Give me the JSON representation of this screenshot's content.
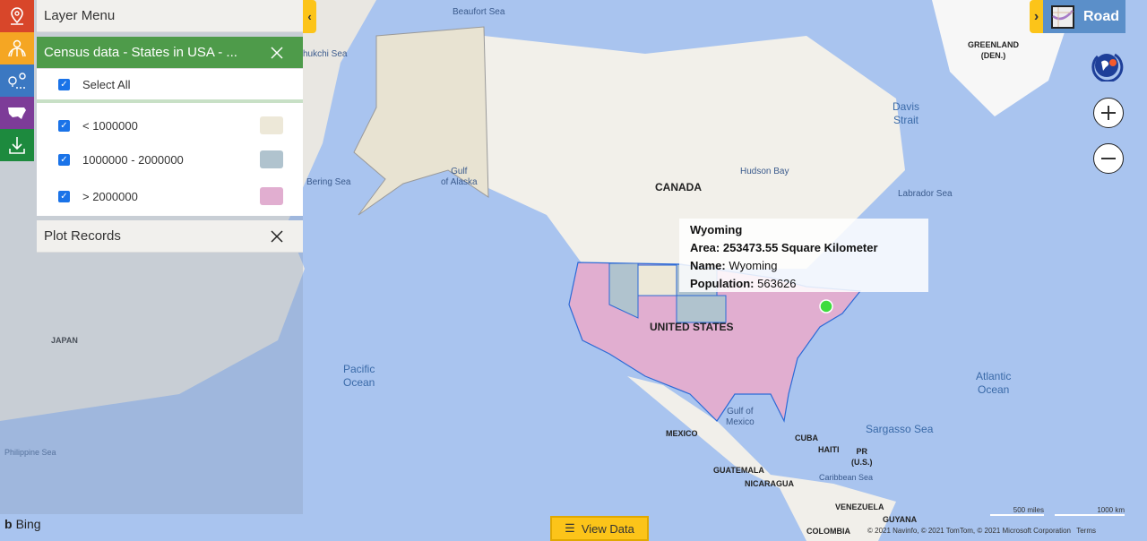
{
  "layer_menu": {
    "title": "Layer Menu"
  },
  "census_panel": {
    "title": "Census data - States in USA - ...",
    "select_all": "Select All",
    "items": [
      {
        "label": "< 1000000",
        "color": "#ede8d8",
        "checked": true
      },
      {
        "label": "1000000 - 2000000",
        "color": "#b0c3ce",
        "checked": true
      },
      {
        "label": "> 2000000",
        "color": "#e1aed0",
        "checked": true
      }
    ]
  },
  "plot_records": {
    "title": "Plot Records"
  },
  "sidebar": {
    "items": [
      {
        "icon": "map-pin-icon",
        "color": "#d8462a"
      },
      {
        "icon": "territory-globe-icon",
        "color": "#f5a623"
      },
      {
        "icon": "route-icon",
        "color": "#3b78c2"
      },
      {
        "icon": "usa-map-icon",
        "color": "#7d3c98"
      },
      {
        "icon": "download-icon",
        "color": "#1d8a3e"
      }
    ]
  },
  "map_type": {
    "label": "Road"
  },
  "tooltip": {
    "title": "Wyoming",
    "area": "Area: 253473.55 Square Kilometer",
    "name_label": "Name:",
    "name_value": "Wyoming",
    "pop_label": "Population:",
    "pop_value": "563626"
  },
  "view_data": {
    "label": "View Data"
  },
  "bing": "Bing",
  "scale": {
    "miles": "500 miles",
    "km": "1000 km"
  },
  "attribution": "© 2021 Navinfo, © 2021 TomTom, © 2021 Microsoft Corporation",
  "terms": "Terms",
  "map_labels": {
    "beaufort": "Beaufort Sea",
    "chukchi": "hukchi Sea",
    "greenland": "GREENLAND\n(DEN.)",
    "davis": "Davis\nStrait",
    "hudson": "Hudson Bay",
    "labrador": "Labrador Sea",
    "canada": "CANADA",
    "bering": "Bering Sea",
    "alaska_gulf": "Gulf\nof Alaska",
    "japan": "JAPAN",
    "us": "UNITED STATES",
    "pacific": "Pacific\nOcean",
    "atlantic": "Atlantic\nOcean",
    "sargasso": "Sargasso Sea",
    "mexico_gulf": "Gulf of\nMexico",
    "mexico": "MEXICO",
    "cuba": "CUBA",
    "haiti": "HAITI",
    "pr": "PR\n(U.S.)",
    "guatemala": "GUATEMALA",
    "nicaragua": "NICARAGUA",
    "caribbean": "Caribbean Sea",
    "venezuela": "VENEZUELA",
    "guyana": "GUYANA",
    "colombia": "COLOMBIA",
    "philippine": "Philippine Sea"
  }
}
